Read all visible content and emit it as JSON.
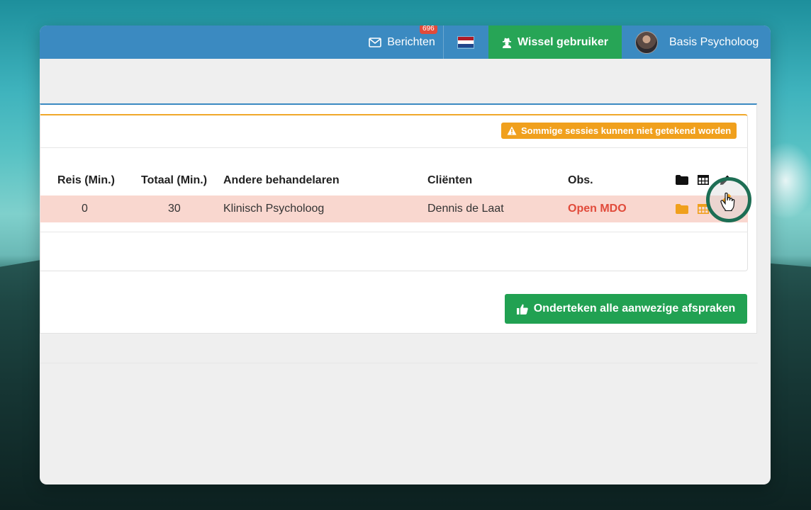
{
  "topbar": {
    "messages_label": "Berichten",
    "messages_count": "696",
    "switch_user_label": "Wissel gebruiker",
    "user_name": "Basis Psycholoog",
    "flag_colors": [
      "#ae1c28",
      "#ffffff",
      "#21468b"
    ]
  },
  "panel": {
    "warning_text": "Sommige sessies kunnen niet getekend worden",
    "columns": {
      "travel": "Reis (Min.)",
      "total": "Totaal (Min.)",
      "other_therapists": "Andere behandelaren",
      "clients": "Cliënten",
      "obs": "Obs."
    },
    "row": {
      "travel": "0",
      "total": "30",
      "other_therapists": "Klinisch Psycholoog",
      "clients": "Dennis de Laat",
      "obs": "Open MDO"
    },
    "sign_all_label": "Onderteken alle aanwezige afspraken"
  },
  "colors": {
    "topbar": "#3b8ac1",
    "switch_user": "#27a556",
    "warning": "#f0a01d",
    "row_highlight": "#f9d7cf",
    "open_mdo": "#e14b3b",
    "sign_button": "#21a152",
    "action_icons": "#f0a01d"
  }
}
